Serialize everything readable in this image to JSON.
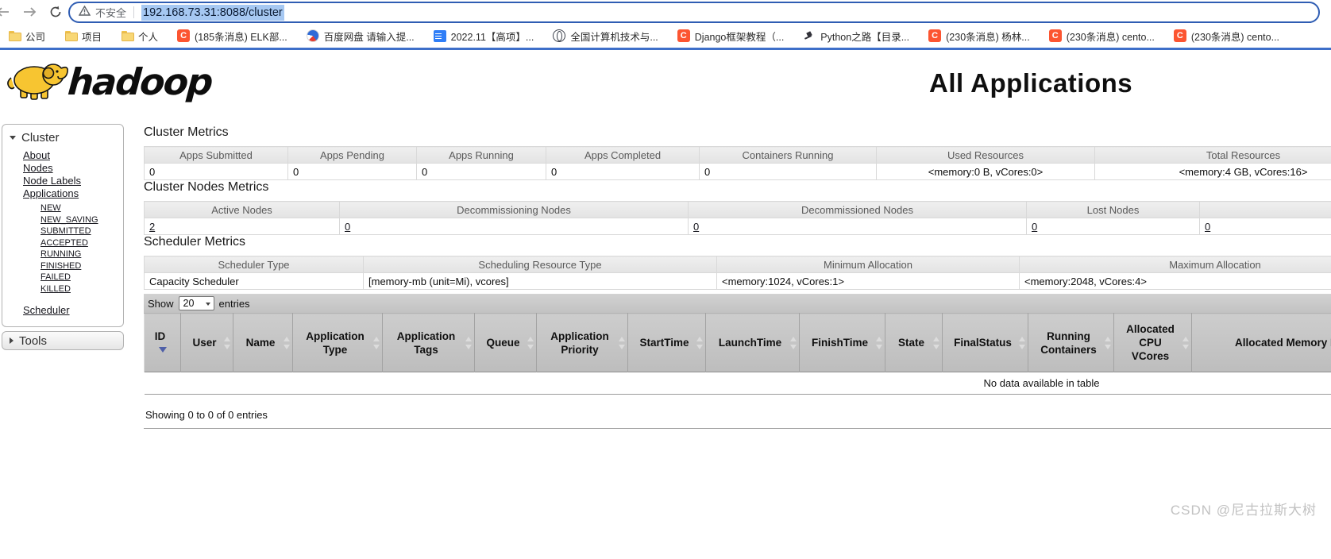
{
  "colors": {
    "accent_blue": "#3e6fc9",
    "csdn_red": "#fc5531",
    "hadoop_yellow": "#f7c531",
    "selection_blue": "#a6c8f2"
  },
  "browser": {
    "security_label": "不安全",
    "url": "192.168.73.31:8088/cluster",
    "bookmarks": [
      {
        "icon": "folder",
        "label": "公司"
      },
      {
        "icon": "folder",
        "label": "项目"
      },
      {
        "icon": "folder",
        "label": "个人"
      },
      {
        "icon": "csdn",
        "label": "(185条消息) ELK部..."
      },
      {
        "icon": "baidu",
        "label": "百度网盘 请输入提..."
      },
      {
        "icon": "doc",
        "label": "2022.11【高项】..."
      },
      {
        "icon": "globe",
        "label": "全国计算机技术与..."
      },
      {
        "icon": "csdn",
        "label": "Django框架教程（..."
      },
      {
        "icon": "quill",
        "label": "Python之路【目录..."
      },
      {
        "icon": "csdn",
        "label": "(230条消息) 杨林..."
      },
      {
        "icon": "csdn",
        "label": "(230条消息) cento..."
      },
      {
        "icon": "csdn",
        "label": "(230条消息) cento..."
      }
    ]
  },
  "page": {
    "logo_text": "hadoop",
    "title": "All Applications",
    "watermark": "CSDN @尼古拉斯大树"
  },
  "sidebar": {
    "cluster": {
      "label": "Cluster",
      "items": [
        "About",
        "Nodes",
        "Node Labels",
        "Applications"
      ],
      "app_states": [
        "NEW",
        "NEW_SAVING",
        "SUBMITTED",
        "ACCEPTED",
        "RUNNING",
        "FINISHED",
        "FAILED",
        "KILLED"
      ],
      "footer_item": "Scheduler"
    },
    "tools": {
      "label": "Tools"
    }
  },
  "cluster_metrics": {
    "heading": "Cluster Metrics",
    "columns": [
      "Apps Submitted",
      "Apps Pending",
      "Apps Running",
      "Apps Completed",
      "Containers Running",
      "Used Resources",
      "Total Resources"
    ],
    "values": [
      "0",
      "0",
      "0",
      "0",
      "0",
      "<memory:0 B, vCores:0>",
      "<memory:4 GB, vCores:16>"
    ]
  },
  "nodes_metrics": {
    "heading": "Cluster Nodes Metrics",
    "columns": [
      "Active Nodes",
      "Decommissioning Nodes",
      "Decommissioned Nodes",
      "Lost Nodes"
    ],
    "values": [
      "2",
      "0",
      "0",
      "0",
      "0"
    ]
  },
  "scheduler_metrics": {
    "heading": "Scheduler Metrics",
    "columns": [
      "Scheduler Type",
      "Scheduling Resource Type",
      "Minimum Allocation",
      "Maximum Allocation"
    ],
    "values": [
      "Capacity Scheduler",
      "[memory-mb (unit=Mi), vcores]",
      "<memory:1024, vCores:1>",
      "<memory:2048, vCores:4>"
    ]
  },
  "apps_table": {
    "show_label": "Show",
    "page_size": "20",
    "entries_label": "entries",
    "columns": [
      "ID",
      "User",
      "Name",
      "Application Type",
      "Application Tags",
      "Queue",
      "Application Priority",
      "StartTime",
      "LaunchTime",
      "FinishTime",
      "State",
      "FinalStatus",
      "Running Containers",
      "Allocated CPU VCores",
      "Allocated Memory MB"
    ],
    "empty_text": "No data available in table",
    "info_text": "Showing 0 to 0 of 0 entries"
  }
}
